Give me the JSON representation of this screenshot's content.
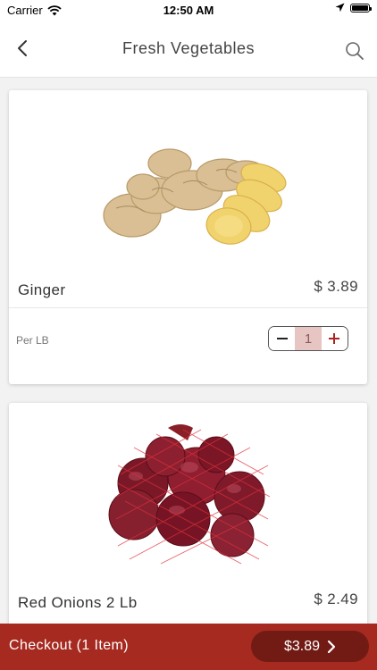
{
  "status_bar": {
    "carrier": "Carrier",
    "time": "12:50 AM"
  },
  "nav": {
    "title": "Fresh Vegetables"
  },
  "products": [
    {
      "name": "Ginger",
      "price": "$ 3.89",
      "unit": "Per LB",
      "quantity": "1",
      "image": "ginger-root-photo"
    },
    {
      "name": "Red Onions 2 Lb",
      "price": "$ 2.49",
      "image": "red-onions-in-net-bag-photo"
    }
  ],
  "checkout": {
    "label": "Checkout (1 Item)",
    "total": "$3.89"
  },
  "colors": {
    "brand": "#a62a20",
    "brand_dark": "#721b14",
    "stepper_fill": "#e7c5c3"
  },
  "icons": [
    "wifi-icon",
    "location-arrow-icon",
    "battery-icon",
    "back-chevron-icon",
    "search-icon",
    "minus-icon",
    "plus-icon",
    "chevron-right-icon"
  ]
}
